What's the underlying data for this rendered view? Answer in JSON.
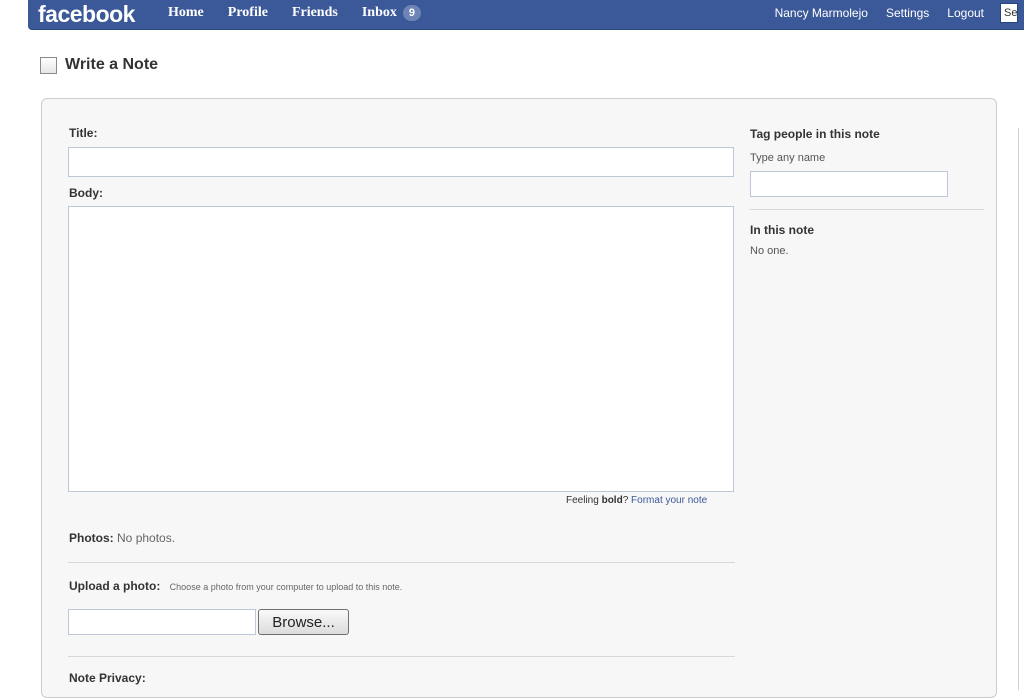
{
  "topbar": {
    "logo": "facebook",
    "nav_left": [
      {
        "label": "Home"
      },
      {
        "label": "Profile"
      },
      {
        "label": "Friends"
      },
      {
        "label": "Inbox",
        "badge": "9"
      }
    ],
    "nav_right": [
      {
        "label": "Nancy Marmolejo"
      },
      {
        "label": "Settings"
      },
      {
        "label": "Logout"
      }
    ],
    "search_value": "Se",
    "color": "#3b5998"
  },
  "page": {
    "title": "Write a Note",
    "icon": "note-icon"
  },
  "form": {
    "title_label": "Title:",
    "title_value": "",
    "body_label": "Body:",
    "body_value": "",
    "feeling_prefix": "Feeling",
    "feeling_bold": "bold",
    "feeling_q": "?",
    "format_link": "Format your note",
    "photos_label": "Photos:",
    "photos_value": "No photos.",
    "upload_label": "Upload a photo:",
    "upload_hint": "Choose a photo from your computer to upload to this note.",
    "file_value": "",
    "browse_label": "Browse...",
    "privacy_label": "Note Privacy:"
  },
  "sidebar": {
    "tag_heading": "Tag people in this note",
    "tag_hint": "Type any name",
    "tag_value": "",
    "in_note_heading": "In this note",
    "in_note_value": "No one."
  }
}
